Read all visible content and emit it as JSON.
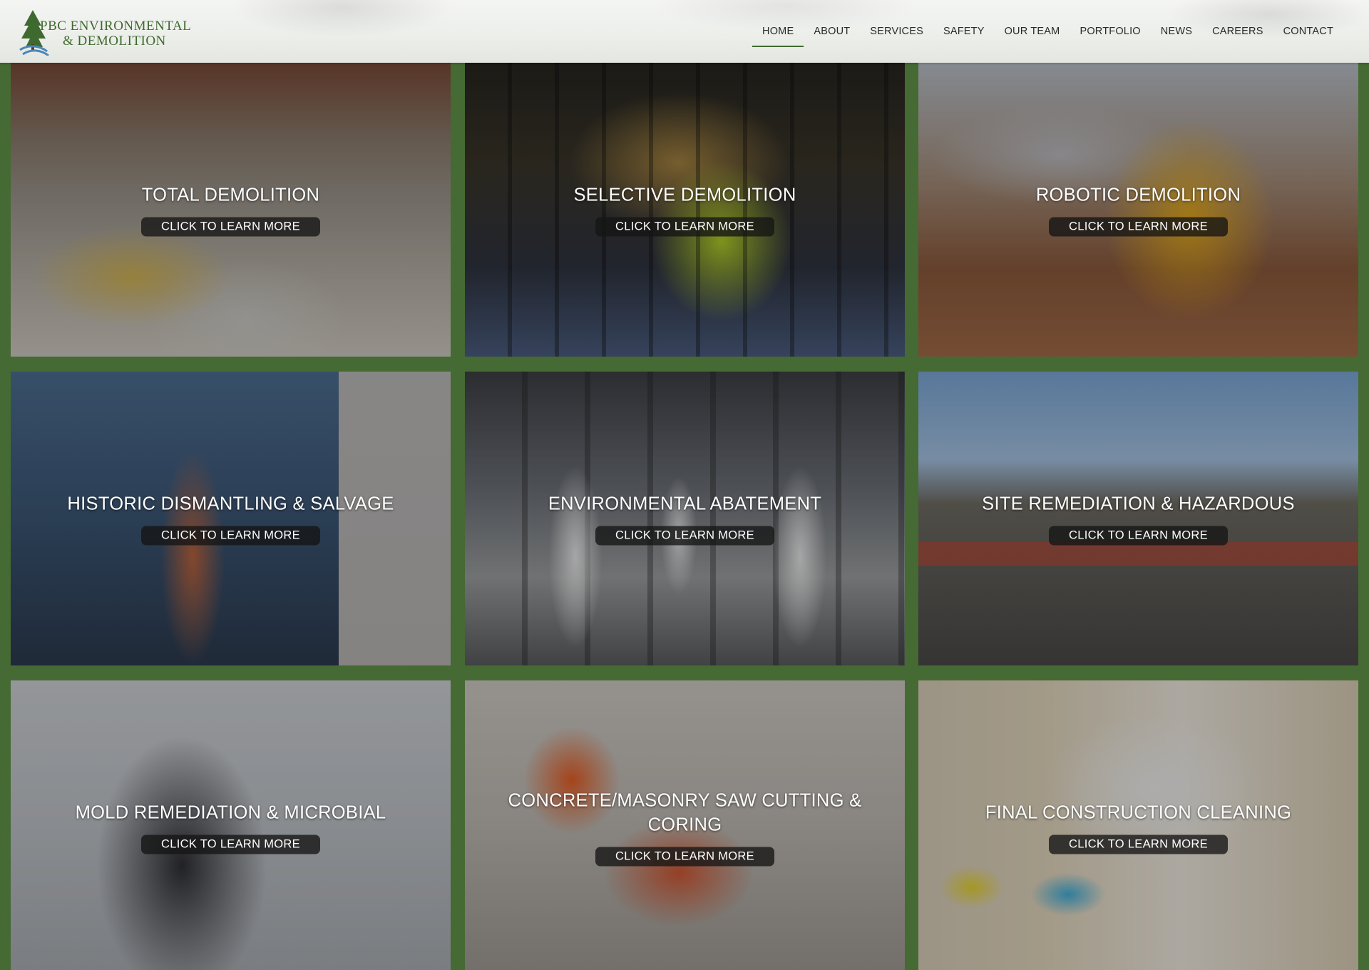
{
  "header": {
    "logo": {
      "line1": "PBC ENVIRONMENTAL",
      "line2": "& DEMOLITION"
    },
    "nav": [
      {
        "label": "HOME",
        "active": true
      },
      {
        "label": "ABOUT"
      },
      {
        "label": "SERVICES"
      },
      {
        "label": "SAFETY"
      },
      {
        "label": "OUR TEAM"
      },
      {
        "label": "PORTFOLIO"
      },
      {
        "label": "NEWS"
      },
      {
        "label": "CAREERS"
      },
      {
        "label": "CONTACT"
      }
    ]
  },
  "services": [
    {
      "title": "TOTAL DEMOLITION",
      "cta": "CLICK TO LEARN MORE"
    },
    {
      "title": "SELECTIVE DEMOLITION",
      "cta": "CLICK TO LEARN MORE"
    },
    {
      "title": "ROBOTIC DEMOLITION",
      "cta": "CLICK TO LEARN MORE"
    },
    {
      "title": "HISTORIC DISMANTLING & SALVAGE",
      "cta": "CLICK TO LEARN MORE"
    },
    {
      "title": "ENVIRONMENTAL ABATEMENT",
      "cta": "CLICK TO LEARN MORE"
    },
    {
      "title": "SITE REMEDIATION & HAZARDOUS",
      "cta": "CLICK TO LEARN MORE"
    },
    {
      "title": "MOLD REMEDIATION & MICROBIAL",
      "cta": "CLICK TO LEARN MORE"
    },
    {
      "title": "CONCRETE/MASONRY SAW CUTTING & CORING",
      "cta": "CLICK TO LEARN MORE"
    },
    {
      "title": "FINAL CONSTRUCTION CLEANING",
      "cta": "CLICK TO LEARN MORE"
    }
  ],
  "colors": {
    "brand_green": "#456a33",
    "logo_green": "#3f6a2f",
    "logo_blue": "#4a86b8"
  }
}
